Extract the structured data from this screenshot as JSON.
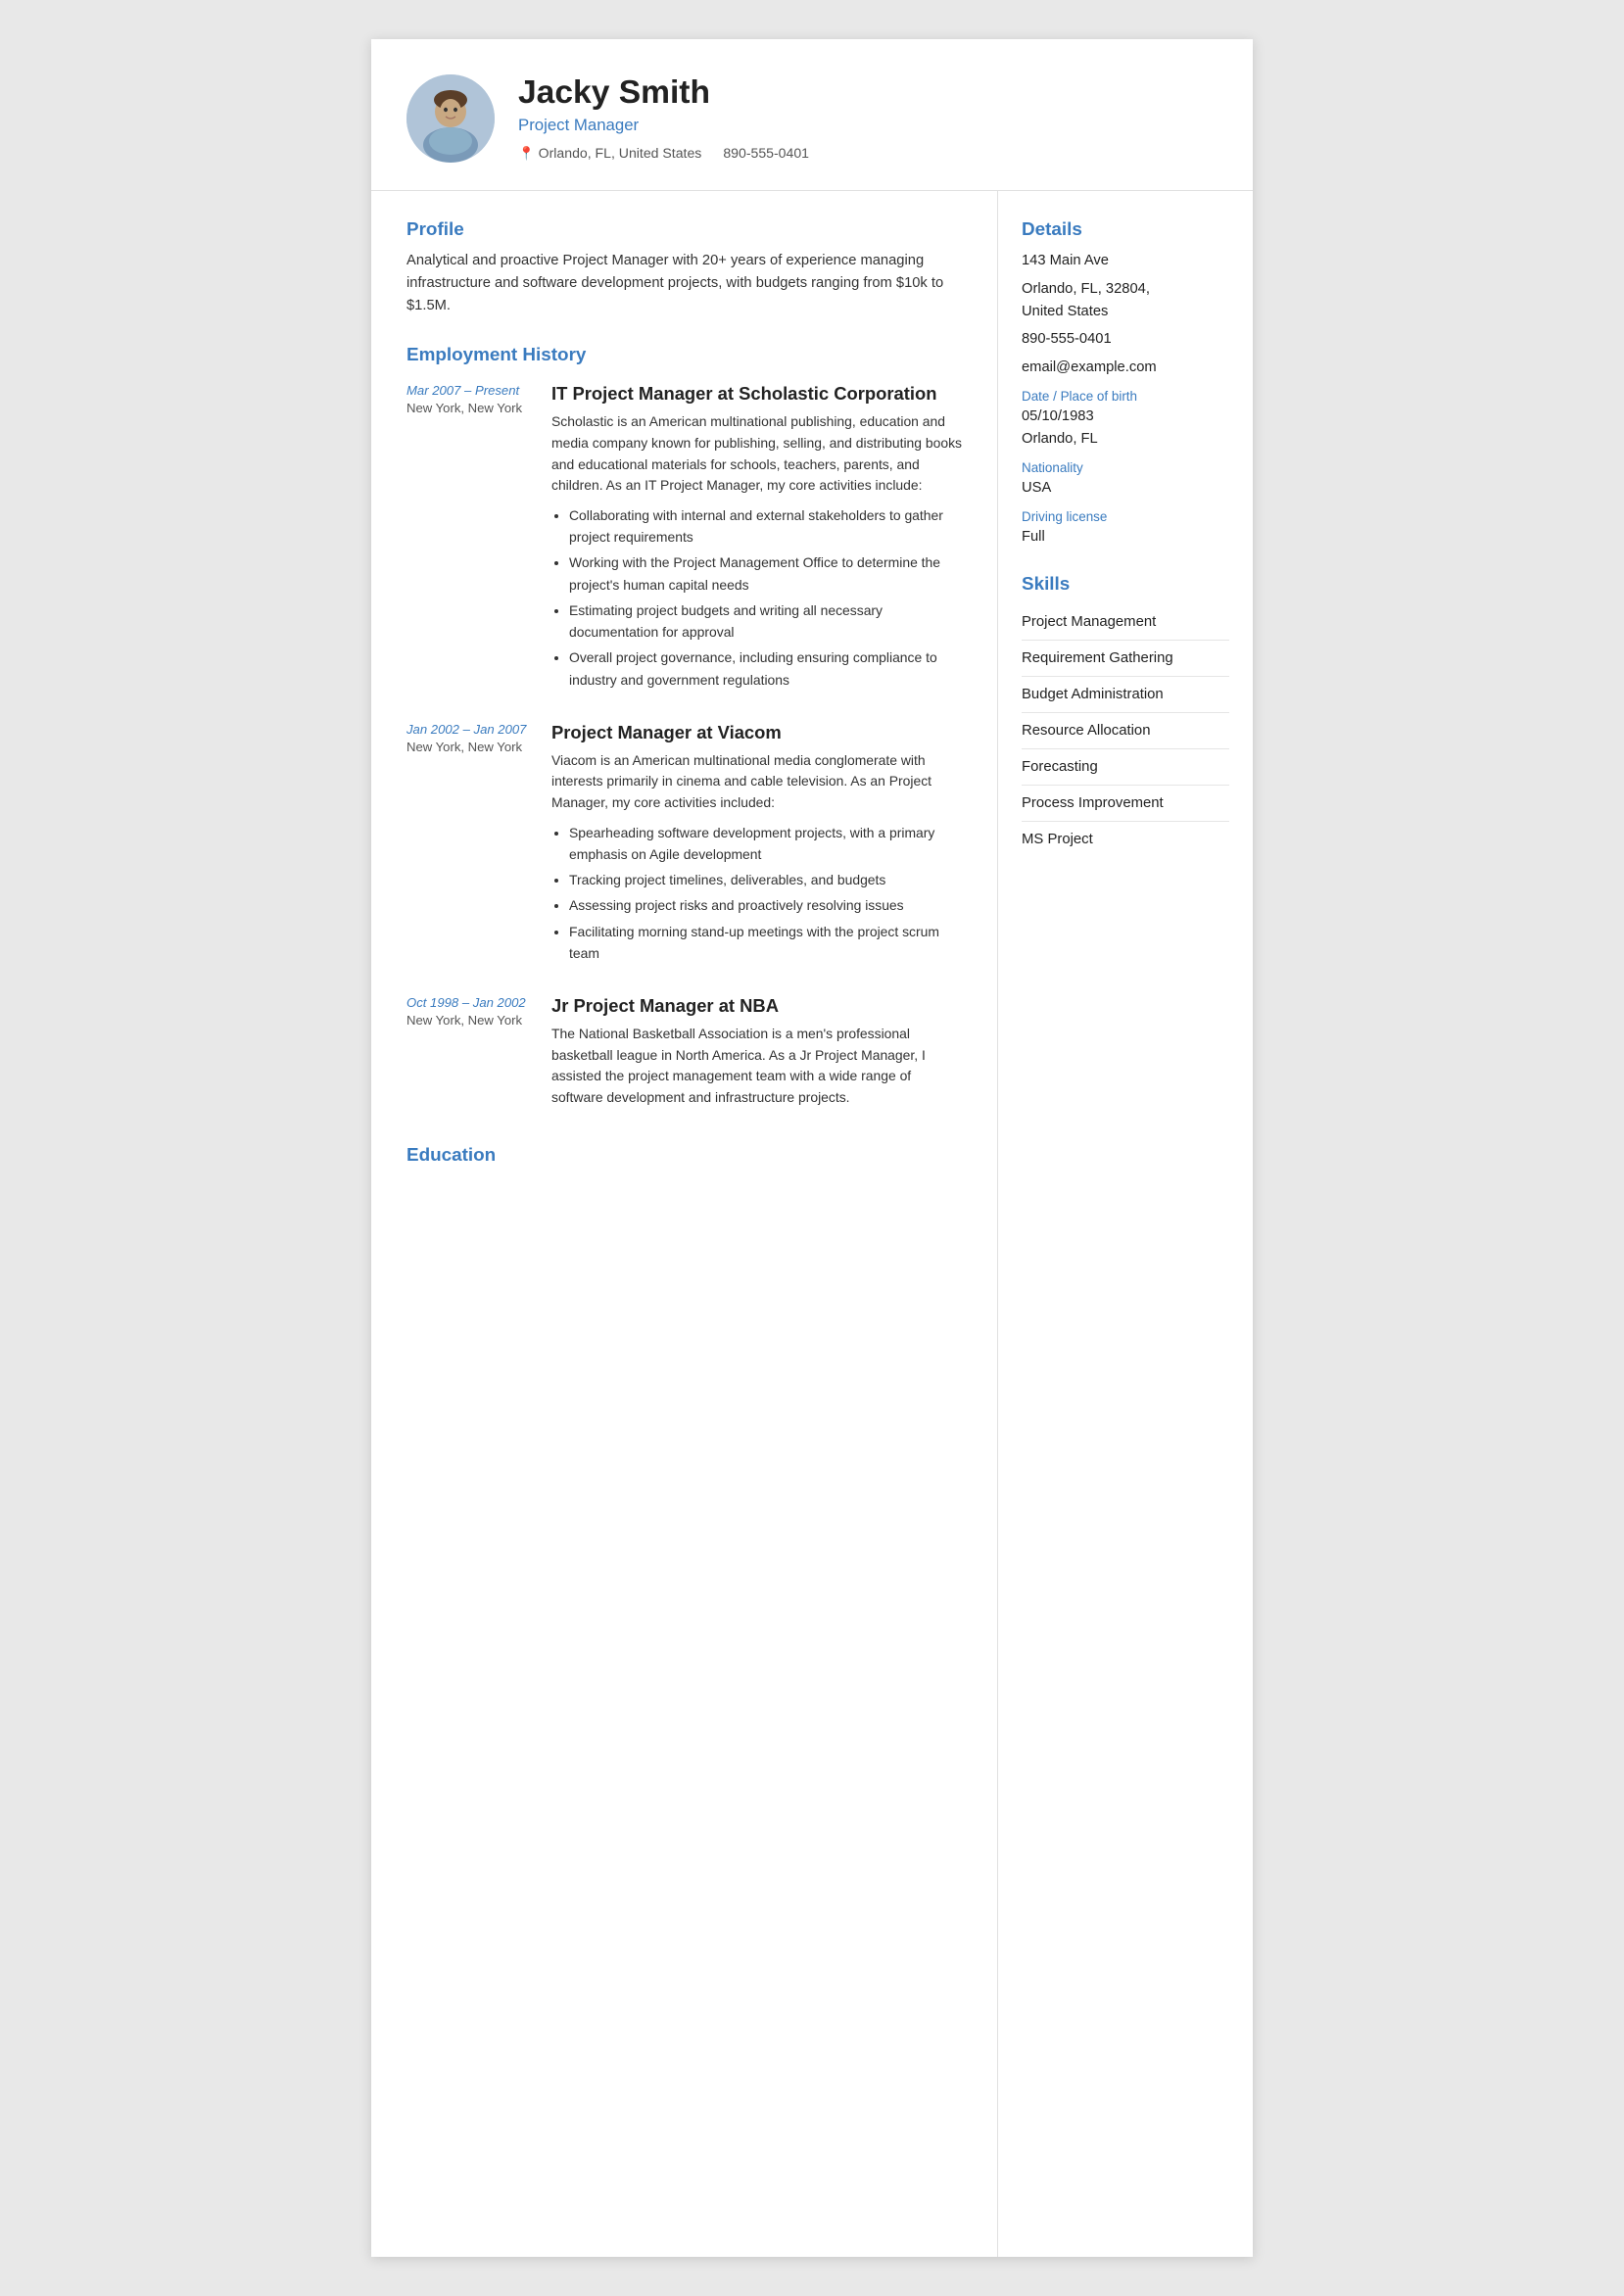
{
  "header": {
    "name": "Jacky Smith",
    "title": "Project Manager",
    "location": "Orlando, FL, United States",
    "phone": "890-555-0401"
  },
  "profile": {
    "section_title": "Profile",
    "text": "Analytical and proactive Project Manager with 20+ years of experience managing infrastructure and software development projects, with budgets ranging from $10k to $1.5M."
  },
  "employment": {
    "section_title": "Employment History",
    "jobs": [
      {
        "dates": "Mar 2007 – Present",
        "location": "New York, New York",
        "title": "IT Project Manager at Scholastic Corporation",
        "description": "Scholastic is an American multinational publishing, education and media company known for publishing, selling, and distributing books and educational materials for schools, teachers, parents, and children. As an IT Project Manager, my core activities include:",
        "bullets": [
          "Collaborating with internal and external stakeholders to gather project requirements",
          "Working with the Project Management Office to determine the project's human capital needs",
          "Estimating project budgets and writing all necessary documentation for approval",
          "Overall project governance, including ensuring compliance to industry and government regulations"
        ]
      },
      {
        "dates": "Jan 2002 – Jan 2007",
        "location": "New York, New York",
        "title": "Project Manager at Viacom",
        "description": "Viacom is an American multinational media conglomerate with interests primarily in cinema and cable television. As an Project Manager, my core activities included:",
        "bullets": [
          "Spearheading software development projects, with a primary emphasis on Agile development",
          "Tracking project timelines, deliverables, and budgets",
          "Assessing project risks and proactively resolving issues",
          "Facilitating morning stand-up meetings with the project scrum team"
        ]
      },
      {
        "dates": "Oct 1998 – Jan 2002",
        "location": "New York, New York",
        "title": "Jr Project Manager at NBA",
        "description": "The National Basketball Association is a men's professional basketball league in North America. As a Jr Project Manager, I assisted the project management team with a wide range of software development and infrastructure projects.",
        "bullets": []
      }
    ]
  },
  "education": {
    "section_title": "Education"
  },
  "details": {
    "section_title": "Details",
    "address1": "143 Main Ave",
    "address2": "Orlando, FL, 32804,",
    "address3": "United States",
    "phone": "890-555-0401",
    "email": "email@example.com",
    "dob_label": "Date / Place of birth",
    "dob_value": "05/10/1983",
    "dob_place": "Orlando, FL",
    "nationality_label": "Nationality",
    "nationality_value": "USA",
    "driving_label": "Driving license",
    "driving_value": "Full"
  },
  "skills": {
    "section_title": "Skills",
    "items": [
      "Project Management",
      "Requirement Gathering",
      "Budget Administration",
      "Resource Allocation",
      "Forecasting",
      "Process Improvement",
      "MS Project"
    ]
  }
}
